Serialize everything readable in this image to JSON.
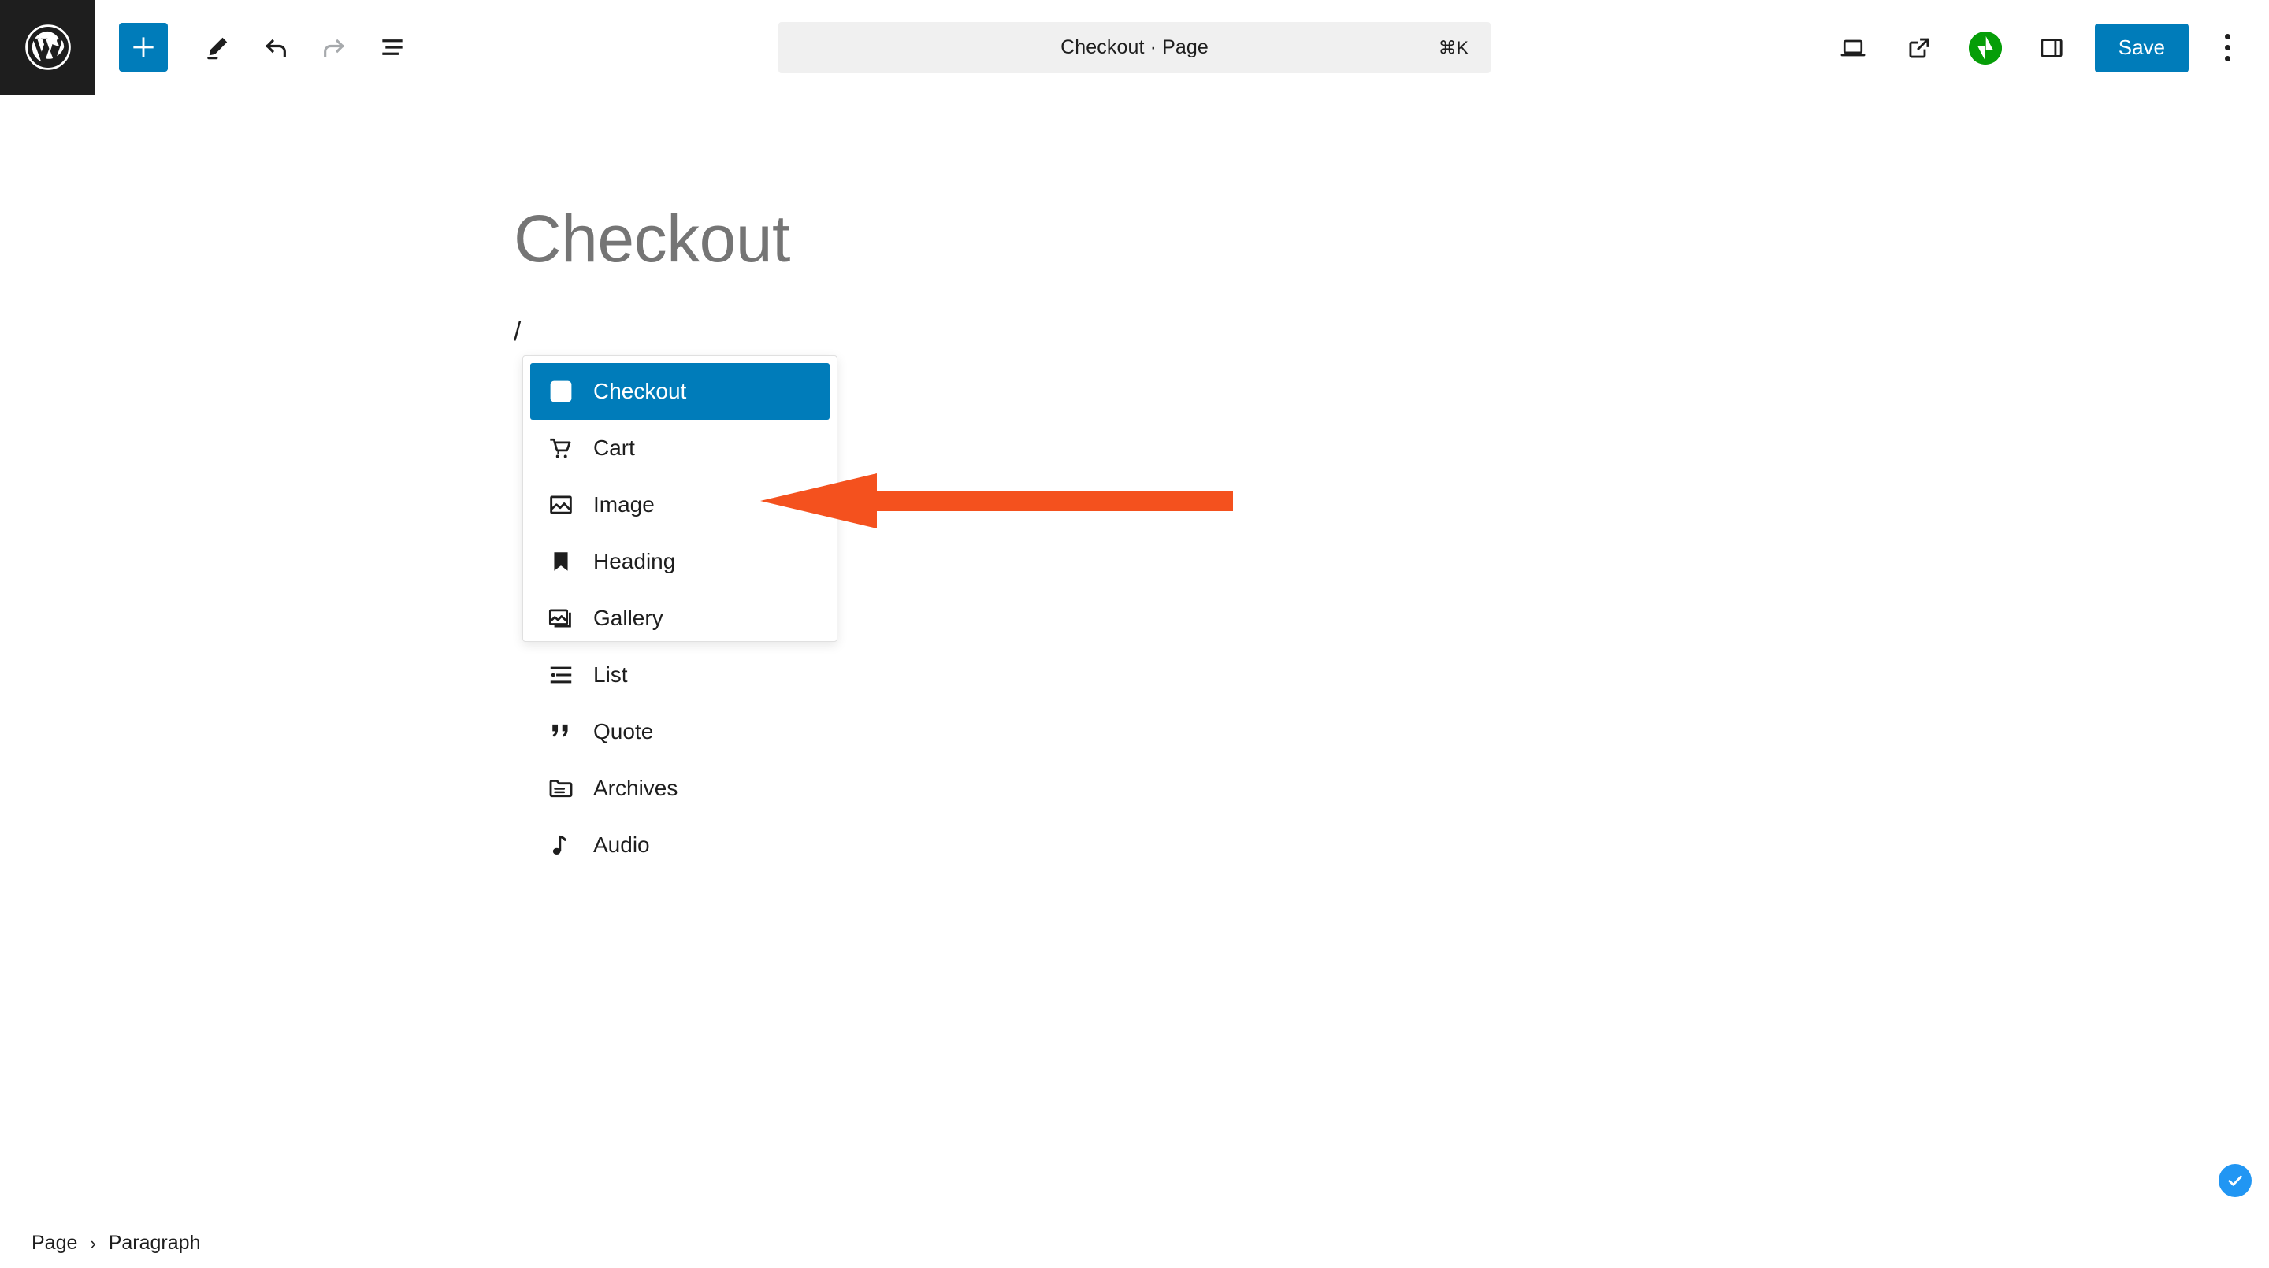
{
  "header": {
    "logo_icon": "wordpress-logo-icon",
    "left_tools": [
      {
        "name": "add-block-button",
        "icon": "plus-icon",
        "label": "Add block",
        "active": true
      },
      {
        "name": "tools-button",
        "icon": "pencil-icon",
        "label": "Tools"
      },
      {
        "name": "undo-button",
        "icon": "undo-arrow-icon",
        "label": "Undo",
        "disabled": false
      },
      {
        "name": "redo-button",
        "icon": "redo-arrow-icon",
        "label": "Redo",
        "disabled": true
      },
      {
        "name": "document-overview-button",
        "icon": "list-view-icon",
        "label": "Document Overview"
      }
    ],
    "command_bar": {
      "title": "Checkout · Page",
      "shortcut": "⌘K"
    },
    "right_tools": [
      {
        "name": "view-button",
        "icon": "laptop-icon",
        "label": "View"
      },
      {
        "name": "preview-external-button",
        "icon": "external-link-icon",
        "label": "Preview in new tab"
      },
      {
        "name": "jetpack-button",
        "icon": "jetpack-icon",
        "label": "Jetpack"
      },
      {
        "name": "settings-sidebar-button",
        "icon": "sidebar-panel-icon",
        "label": "Settings"
      }
    ],
    "save_label": "Save",
    "options_icon": "kebab-menu-icon"
  },
  "canvas": {
    "post_title": "Checkout",
    "paragraph_text": "/"
  },
  "slash_inserter": {
    "selected_index": 0,
    "items": [
      {
        "label": "Checkout",
        "icon": "checkout-form-icon"
      },
      {
        "label": "Cart",
        "icon": "shopping-cart-icon"
      },
      {
        "label": "Image",
        "icon": "image-icon"
      },
      {
        "label": "Heading",
        "icon": "heading-bookmark-icon"
      },
      {
        "label": "Gallery",
        "icon": "gallery-icon"
      },
      {
        "label": "List",
        "icon": "bullet-list-icon"
      },
      {
        "label": "Quote",
        "icon": "quote-marks-icon"
      },
      {
        "label": "Archives",
        "icon": "archives-folder-icon"
      },
      {
        "label": "Audio",
        "icon": "audio-note-icon"
      }
    ]
  },
  "annotation": {
    "arrow_icon": "left-pointing-arrow-icon",
    "arrow_color": "#f4511e",
    "points_at": "Checkout"
  },
  "footer": {
    "breadcrumb": [
      {
        "label": "Page"
      },
      {
        "label": "Paragraph"
      }
    ],
    "separator": "›"
  },
  "floating_badge": {
    "icon": "checkmark-circle-icon",
    "color": "#2196f3"
  },
  "colors": {
    "accent_blue": "#007cba",
    "jetpack_green": "#069e08",
    "annotation_orange": "#f4511e",
    "badge_blue": "#2196f3",
    "chrome_dark": "#1e1e1e"
  }
}
